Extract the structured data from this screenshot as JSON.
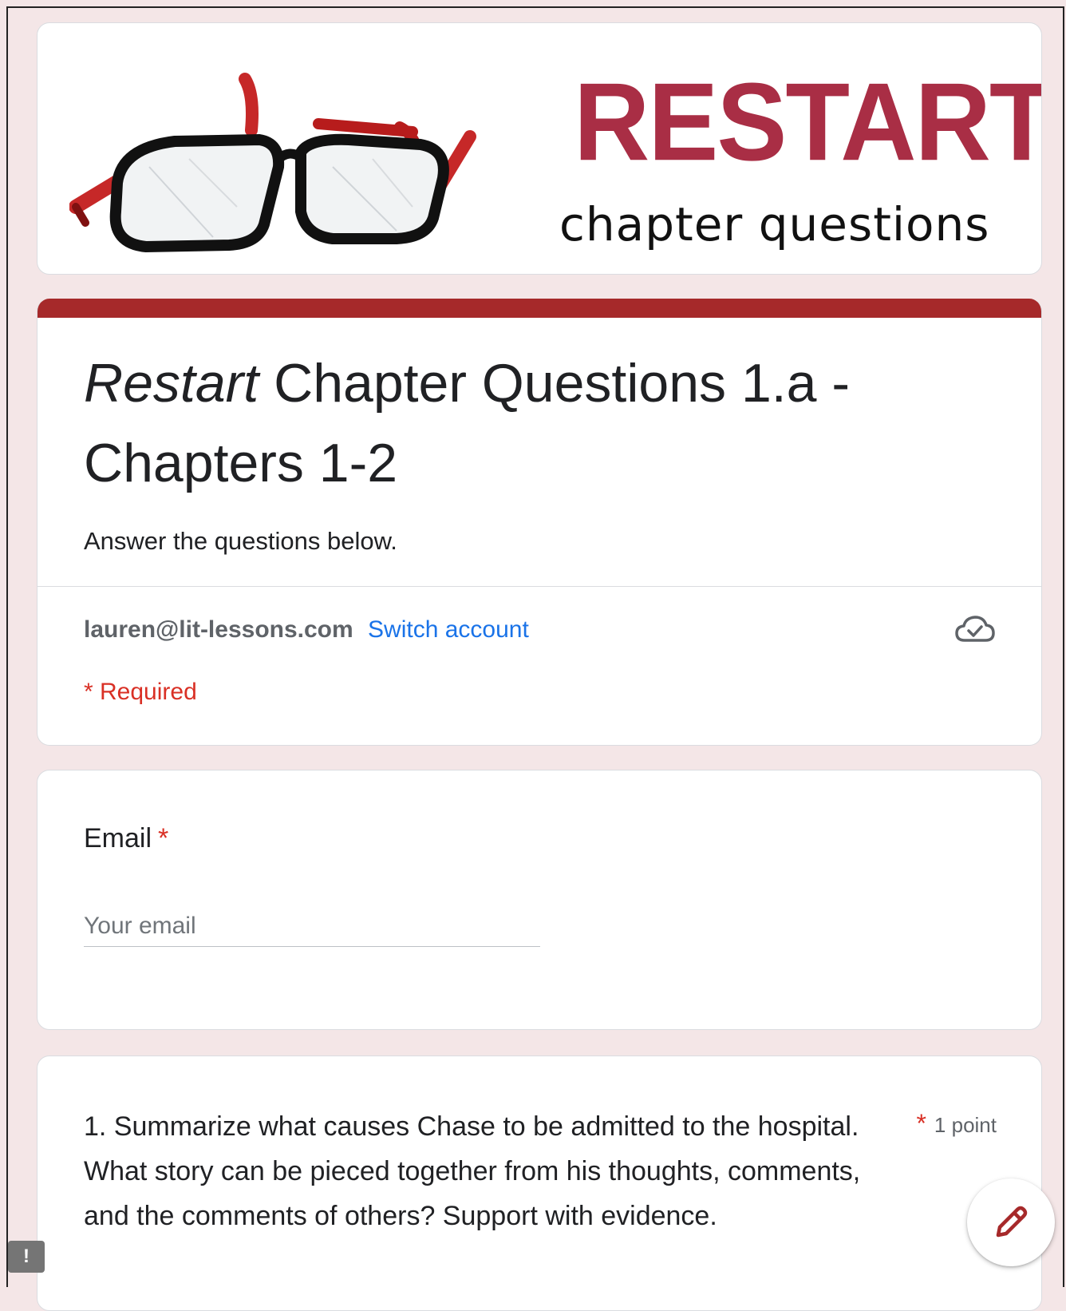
{
  "header": {
    "brand_title": "RESTART",
    "brand_subtitle": "chapter questions"
  },
  "form": {
    "title_italic": "Restart",
    "title_rest": " Chapter Questions 1.a - Chapters 1-2",
    "description": "Answer the questions below.",
    "account_email": "lauren@lit-lessons.com",
    "switch_account_label": "Switch account",
    "required_note": "* Required"
  },
  "email_question": {
    "label": "Email",
    "required_mark": "*",
    "placeholder": "Your email"
  },
  "question_1": {
    "text": "1. Summarize what causes Chase to be admitted to the hospital. What story can be pieced together from his thoughts, comments, and the comments of others? Support with evidence.",
    "required_mark": "*",
    "points": "1 point"
  },
  "feedback_badge": {
    "label": "!"
  },
  "colors": {
    "accent": "#a6292a",
    "brand": "#a92e45",
    "link": "#1a73e8",
    "required": "#d93025",
    "page_background": "#f4e6e7"
  },
  "icons": {
    "cloud": "cloud-saved-icon",
    "edit": "pencil-icon",
    "glasses": "broken-glasses-icon"
  }
}
